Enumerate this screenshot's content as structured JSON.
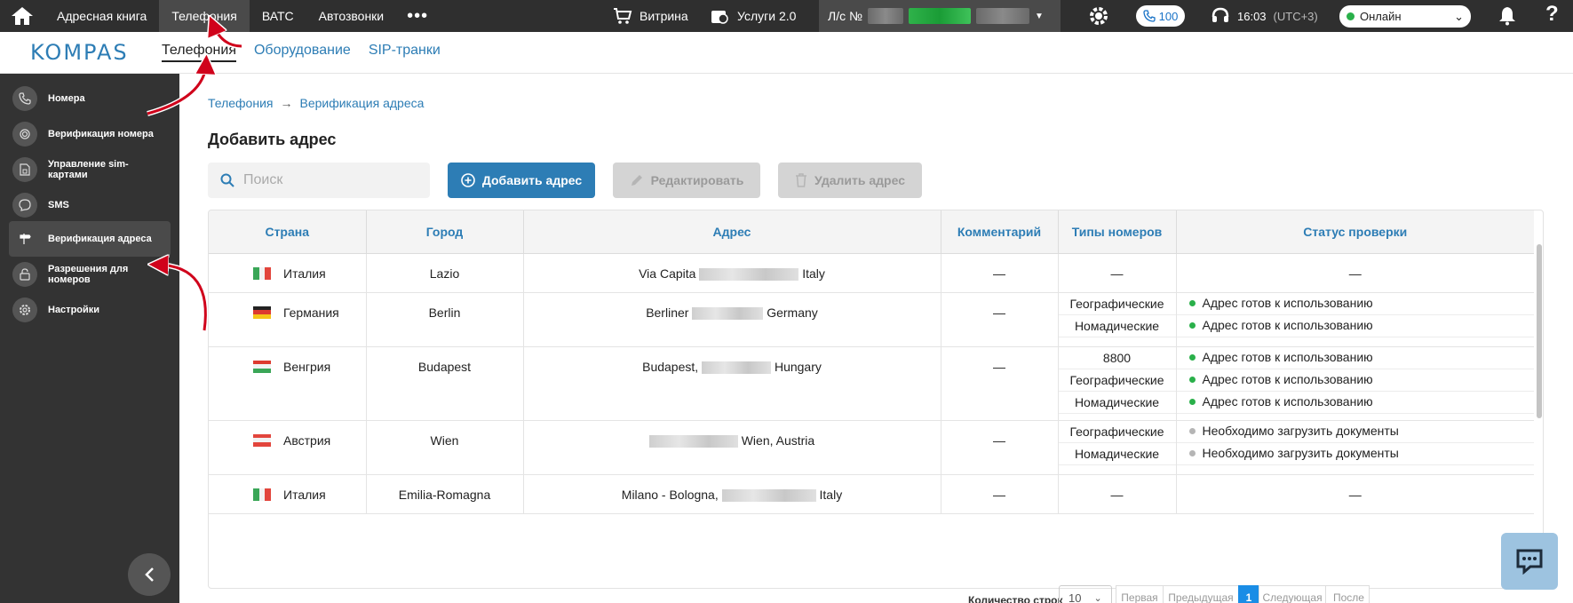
{
  "topbar": {
    "nav": [
      "Адресная книга",
      "Телефония",
      "ВАТС",
      "Автозвонки"
    ],
    "more": "•••",
    "shop": "Витрина",
    "services": "Услуги 2.0",
    "account_label": "Л/с №",
    "calls_count": "100",
    "time": "16:03",
    "timezone": "(UTC+3)",
    "status": "Онлайн",
    "help": "?"
  },
  "subheader": {
    "logo": "KOMPAS",
    "tabs": [
      "Телефония",
      "Оборудование",
      "SIP-транки"
    ]
  },
  "sidebar": {
    "items": [
      {
        "label": "Номера",
        "icon": "phone-icon"
      },
      {
        "label": "Верификация номера",
        "icon": "fingerprint-icon"
      },
      {
        "label": "Управление sim-картами",
        "icon": "sim-card-icon"
      },
      {
        "label": "SMS",
        "icon": "chat-icon"
      },
      {
        "label": "Верификация адреса",
        "icon": "signpost-icon"
      },
      {
        "label": "Разрешения для номеров",
        "icon": "lock-icon"
      },
      {
        "label": "Настройки",
        "icon": "gear-icon"
      }
    ],
    "active_index": 4
  },
  "breadcrumb": {
    "root": "Телефония",
    "separator": "→",
    "current": "Верификация адреса"
  },
  "page_title": "Добавить адрес",
  "search": {
    "placeholder": "Поиск",
    "value": ""
  },
  "actions": {
    "add": "Добавить адрес",
    "edit": "Редактировать",
    "delete": "Удалить адрес"
  },
  "table": {
    "headers": [
      "Страна",
      "Город",
      "Адрес",
      "Комментарий",
      "Типы номеров",
      "Статус проверки"
    ],
    "rows": [
      {
        "country": "Италия",
        "flag": "it",
        "city": "Lazio",
        "address_prefix": "Via Capita",
        "address_suffix": "Italy",
        "comment": "—",
        "types": [
          "—"
        ],
        "statuses": [
          {
            "text": "—",
            "color": ""
          }
        ]
      },
      {
        "country": "Германия",
        "flag": "de",
        "city": "Berlin",
        "address_prefix": "Berliner",
        "address_suffix": "Germany",
        "comment": "—",
        "types": [
          "Географические",
          "Номадические"
        ],
        "statuses": [
          {
            "text": "Адрес готов к использованию",
            "color": "#2ab04a"
          },
          {
            "text": "Адрес готов к использованию",
            "color": "#2ab04a"
          }
        ]
      },
      {
        "country": "Венгрия",
        "flag": "hu",
        "city": "Budapest",
        "address_prefix": "Budapest,",
        "address_suffix": "Hungary",
        "comment": "—",
        "types": [
          "8800",
          "Географические",
          "Номадические"
        ],
        "statuses": [
          {
            "text": "Адрес готов к использованию",
            "color": "#2ab04a"
          },
          {
            "text": "Адрес готов к использованию",
            "color": "#2ab04a"
          },
          {
            "text": "Адрес готов к использованию",
            "color": "#2ab04a"
          }
        ]
      },
      {
        "country": "Австрия",
        "flag": "at",
        "city": "Wien",
        "address_prefix": "",
        "address_suffix": "Wien, Austria",
        "comment": "—",
        "types": [
          "Географические",
          "Номадические"
        ],
        "statuses": [
          {
            "text": "Необходимо загрузить документы",
            "color": "#b5b5b5"
          },
          {
            "text": "Необходимо загрузить документы",
            "color": "#b5b5b5"
          }
        ]
      },
      {
        "country": "Италия",
        "flag": "it",
        "city": "Emilia-Romagna",
        "address_prefix": "Milano - Bologna,",
        "address_suffix": "Italy",
        "comment": "—",
        "types": [
          "—"
        ],
        "statuses": [
          {
            "text": "—",
            "color": ""
          }
        ]
      }
    ]
  },
  "pagination": {
    "rows_label": "Количество строк",
    "rows_value": "10",
    "first": "Первая",
    "prev": "Предыдущая",
    "current": "1",
    "next": "Следующая",
    "last": "После"
  },
  "colors": {
    "accent": "#2d7db5",
    "ready": "#2ab04a",
    "pending": "#b5b5b5",
    "topbar": "#2f2f2f"
  }
}
